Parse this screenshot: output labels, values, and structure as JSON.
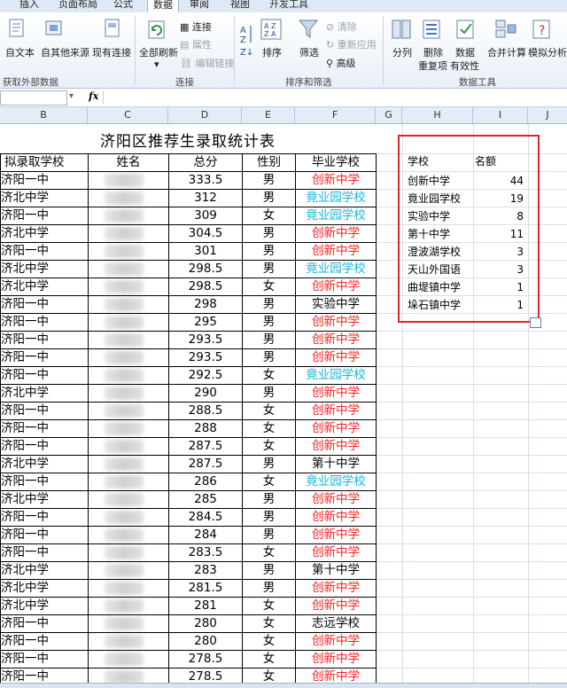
{
  "ribbon": {
    "tabs": [
      "插入",
      "页面布局",
      "公式",
      "数据",
      "审阅",
      "视图",
      "开发工具"
    ],
    "active_tab": "数据",
    "buttons": {
      "from_text": "自文本",
      "other_sources": "自其他来源",
      "existing_conn": "现有连接",
      "refresh_all": "全部刷新",
      "connections": "连接",
      "properties": "属性",
      "edit_links": "编辑链接",
      "sort": "排序",
      "filter": "筛选",
      "clear": "清除",
      "reapply": "重新应用",
      "advanced": "高级",
      "split": "分列",
      "remove_dup_1": "删除",
      "remove_dup_2": "重复项",
      "validation_1": "数据",
      "validation_2": "有效性",
      "consolidate": "合并计算",
      "whatif": "模拟分析"
    },
    "groups": {
      "external": "获取外部数据",
      "connections": "连接",
      "sort_filter": "排序和筛选",
      "data_tools": "数据工具"
    }
  },
  "formula_bar": {
    "fx": "fx"
  },
  "columns": [
    "B",
    "C",
    "D",
    "E",
    "F",
    "G",
    "H",
    "I",
    "J"
  ],
  "sheet": {
    "title": "济阳区推荐生录取统计表",
    "headers": {
      "school": "拟录取学校",
      "name": "姓名",
      "score": "总分",
      "gender": "性别",
      "grad": "毕业学校"
    },
    "rows": [
      {
        "school": "济阳一中",
        "score": "333.5",
        "gender": "男",
        "grad": "创新中学",
        "c": "red"
      },
      {
        "school": "济北中学",
        "score": "312",
        "gender": "男",
        "grad": "竟业园学校",
        "c": "cyan"
      },
      {
        "school": "济阳一中",
        "score": "309",
        "gender": "女",
        "grad": "竟业园学校",
        "c": "cyan"
      },
      {
        "school": "济北中学",
        "score": "304.5",
        "gender": "男",
        "grad": "创新中学",
        "c": "red"
      },
      {
        "school": "济阳一中",
        "score": "301",
        "gender": "男",
        "grad": "创新中学",
        "c": "red"
      },
      {
        "school": "济北中学",
        "score": "298.5",
        "gender": "男",
        "grad": "竟业园学校",
        "c": "cyan"
      },
      {
        "school": "济北中学",
        "score": "298.5",
        "gender": "女",
        "grad": "创新中学",
        "c": "red"
      },
      {
        "school": "济阳一中",
        "score": "298",
        "gender": "男",
        "grad": "实验中学",
        "c": "black"
      },
      {
        "school": "济阳一中",
        "score": "295",
        "gender": "男",
        "grad": "创新中学",
        "c": "red"
      },
      {
        "school": "济阳一中",
        "score": "293.5",
        "gender": "男",
        "grad": "创新中学",
        "c": "red"
      },
      {
        "school": "济阳一中",
        "score": "293.5",
        "gender": "男",
        "grad": "创新中学",
        "c": "red"
      },
      {
        "school": "济阳一中",
        "score": "292.5",
        "gender": "女",
        "grad": "竟业园学校",
        "c": "cyan"
      },
      {
        "school": "济北中学",
        "score": "290",
        "gender": "男",
        "grad": "创新中学",
        "c": "red"
      },
      {
        "school": "济阳一中",
        "score": "288.5",
        "gender": "女",
        "grad": "创新中学",
        "c": "red"
      },
      {
        "school": "济阳一中",
        "score": "288",
        "gender": "女",
        "grad": "创新中学",
        "c": "red"
      },
      {
        "school": "济阳一中",
        "score": "287.5",
        "gender": "女",
        "grad": "创新中学",
        "c": "red"
      },
      {
        "school": "济北中学",
        "score": "287.5",
        "gender": "男",
        "grad": "第十中学",
        "c": "black"
      },
      {
        "school": "济阳一中",
        "score": "286",
        "gender": "女",
        "grad": "竟业园学校",
        "c": "cyan"
      },
      {
        "school": "济北中学",
        "score": "285",
        "gender": "男",
        "grad": "创新中学",
        "c": "red"
      },
      {
        "school": "济阳一中",
        "score": "284.5",
        "gender": "男",
        "grad": "创新中学",
        "c": "red"
      },
      {
        "school": "济阳一中",
        "score": "284",
        "gender": "男",
        "grad": "创新中学",
        "c": "red"
      },
      {
        "school": "济阳一中",
        "score": "283.5",
        "gender": "女",
        "grad": "创新中学",
        "c": "red"
      },
      {
        "school": "济北中学",
        "score": "283",
        "gender": "男",
        "grad": "第十中学",
        "c": "black"
      },
      {
        "school": "济北中学",
        "score": "281.5",
        "gender": "男",
        "grad": "创新中学",
        "c": "red"
      },
      {
        "school": "济北中学",
        "score": "281",
        "gender": "女",
        "grad": "创新中学",
        "c": "red"
      },
      {
        "school": "济阳一中",
        "score": "280",
        "gender": "女",
        "grad": "志远学校",
        "c": "black"
      },
      {
        "school": "济阳一中",
        "score": "280",
        "gender": "女",
        "grad": "创新中学",
        "c": "red"
      },
      {
        "school": "济阳一中",
        "score": "278.5",
        "gender": "女",
        "grad": "创新中学",
        "c": "red"
      },
      {
        "school": "济阳一中",
        "score": "278.5",
        "gender": "女",
        "grad": "创新中学",
        "c": "red"
      }
    ]
  },
  "summary": {
    "headers": {
      "school": "学校",
      "count": "名额"
    },
    "rows": [
      {
        "school": "创新中学",
        "count": "44"
      },
      {
        "school": "竟业园学校",
        "count": "19"
      },
      {
        "school": "实验中学",
        "count": "8"
      },
      {
        "school": "第十中学",
        "count": "11"
      },
      {
        "school": "澄波湖学校",
        "count": "3"
      },
      {
        "school": "天山外国语",
        "count": "3"
      },
      {
        "school": "曲堤镇中学",
        "count": "1"
      },
      {
        "school": "垛石镇中学",
        "count": "1"
      }
    ]
  },
  "colors": {
    "red": "#ff2020",
    "cyan": "#19b8d8",
    "highlight_border": "#e0242b"
  }
}
